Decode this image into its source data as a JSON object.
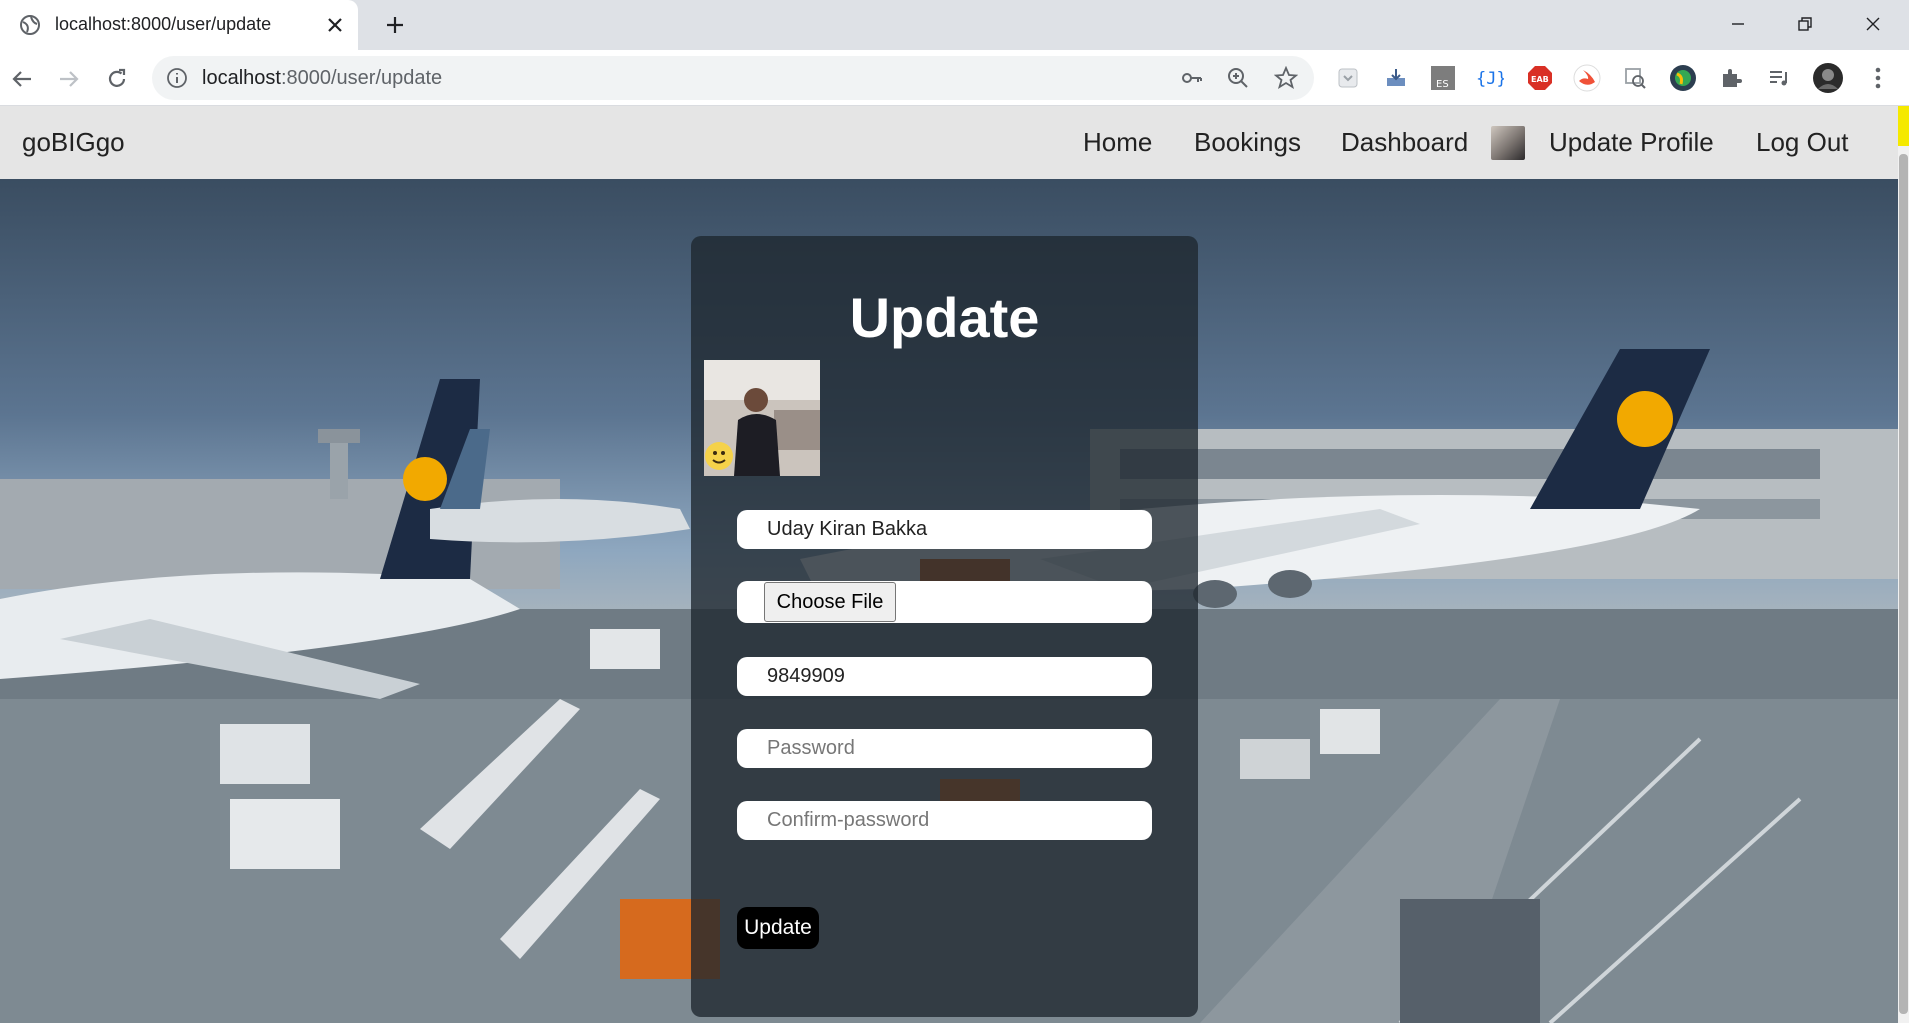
{
  "browser": {
    "tab_title": "localhost:8000/user/update",
    "url_host": "localhost",
    "url_path": ":8000/user/update",
    "extensions": [
      "ext-grey-icon",
      "ext-download-icon",
      "ext-es-icon",
      "ext-json-icon",
      "ext-eab-icon",
      "ext-swift-icon",
      "ext-inspect-icon",
      "ext-globe-icon",
      "extensions-puzzle-icon",
      "media-control-icon"
    ]
  },
  "site": {
    "brand": "goBIGgo",
    "nav": {
      "home": "Home",
      "bookings": "Bookings",
      "dashboard": "Dashboard",
      "update_profile": "Update Profile",
      "logout": "Log Out"
    }
  },
  "form": {
    "title": "Update",
    "name_value": "Uday Kiran Bakka",
    "file_button": "Choose File",
    "phone_value": "9849909",
    "password_placeholder": "Password",
    "confirm_placeholder": "Confirm-password",
    "submit_label": "Update"
  },
  "colors": {
    "nav_bg": "#e5e5e5",
    "card_bg": "rgba(30,38,46,0.78)",
    "submit_bg": "#000000",
    "scroll_indicator": "#f5e900"
  }
}
